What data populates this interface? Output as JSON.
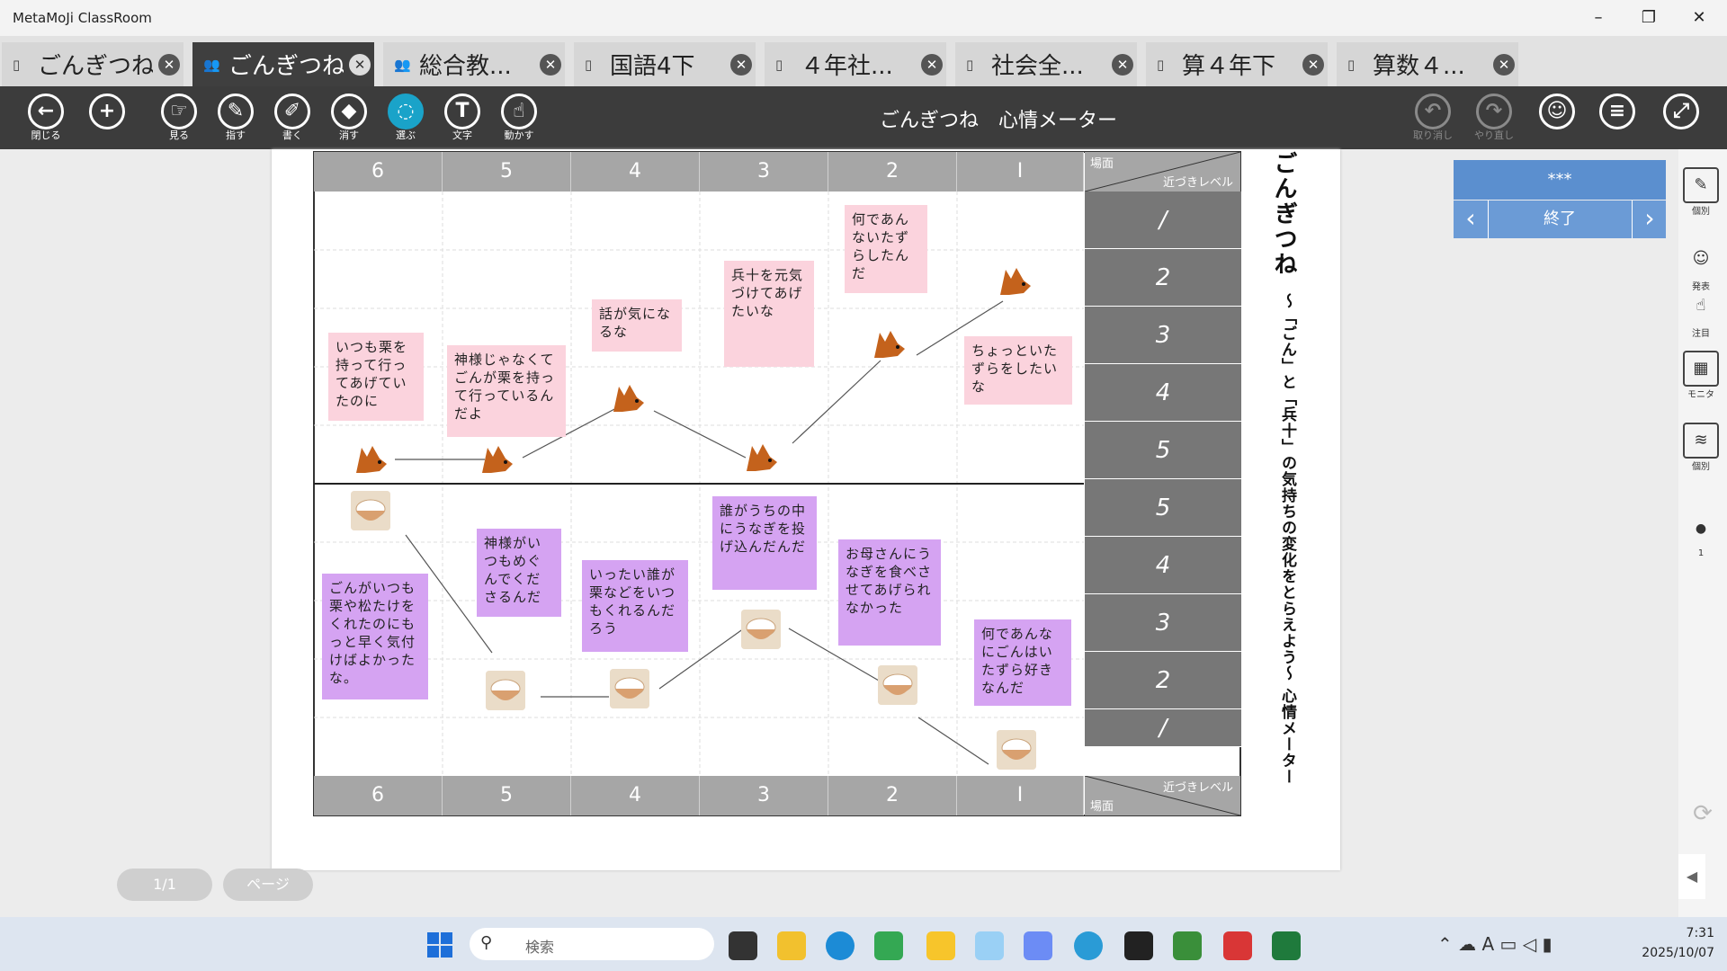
{
  "window": {
    "title": "MetaMoJi ClassRoom",
    "minimize": "–",
    "maximize": "❐",
    "close": "✕"
  },
  "tabs": [
    {
      "label": "ごんぎつね...",
      "icon": "▯",
      "close": "✕"
    },
    {
      "label": "ごんぎつね...",
      "icon": "👥",
      "close": "✕"
    },
    {
      "label": "総合教...",
      "icon": "👥",
      "close": "✕"
    },
    {
      "label": "国語4下",
      "icon": "▯",
      "close": "✕"
    },
    {
      "label": "４年社...",
      "icon": "▯",
      "close": "✕"
    },
    {
      "label": "社会全...",
      "icon": "▯",
      "close": "✕"
    },
    {
      "label": "算４年下",
      "icon": "▯",
      "close": "✕"
    },
    {
      "label": "算数４...",
      "icon": "▯",
      "close": "✕"
    }
  ],
  "toolbar": {
    "close": "閉じる",
    "view": "見る",
    "point": "指す",
    "write": "書く",
    "erase": "消す",
    "select": "選ぶ",
    "text": "文字",
    "move": "動かす",
    "undo": "取り消し",
    "redo": "やり直し",
    "doc_title": "ごんぎつね　心情メーター"
  },
  "sheet": {
    "scenes": [
      "6",
      "5",
      "4",
      "3",
      "2",
      "I"
    ],
    "corner_top": "場面",
    "corner_level": "近づきレベル",
    "levels_top": [
      "/",
      "2",
      "3",
      "4",
      "5"
    ],
    "levels_bottom": [
      "5",
      "4",
      "3",
      "2",
      "/"
    ],
    "title_vertical": "ごんぎつね",
    "subtitle_vertical": "〜「ごん」と「兵十」の気持ちの変化をとらえよう〜 心情メーター 〜",
    "gon_notes": [
      "いつも栗を持って行ってあげていたのに",
      "神様じゃなくてごんが栗を持って行っているんだよ",
      "話が気になるな",
      "兵十を元気づけてあげたいな",
      "何であんないたずらしたんだ",
      "ちょっといたずらをしたいな"
    ],
    "hyoju_notes": [
      "ごんがいつも栗や松たけをくれたのにもっと早く気付けばよかったな。",
      "神様がいつもめぐんでくださるんだ",
      "いったい誰が栗などをいつもくれるんだろう",
      "誰がうちの中にうなぎを投げ込んだんだ",
      "お母さんにうなぎを食べさせてあげられなかった",
      "何であんなにごんはいたずら好きなんだ"
    ]
  },
  "panel": {
    "masked": "***",
    "prev": "‹",
    "end": "終了",
    "next": "›"
  },
  "side_tools": [
    {
      "label": "個別",
      "icon": "✎"
    },
    {
      "label": "発表",
      "icon": "☺"
    },
    {
      "label": "注目",
      "icon": "☝"
    },
    {
      "label": "モニタ",
      "icon": "▦"
    },
    {
      "label": "個別",
      "icon": "≋"
    },
    {
      "label": "1",
      "icon": "●"
    }
  ],
  "page": {
    "indicator": "1/1",
    "page_button": "ページ"
  },
  "taskbar": {
    "search_placeholder": "検索",
    "time": "7:31",
    "date": "2025/10/07"
  },
  "colors": {
    "toolbar": "#3c3c3c",
    "selected_tool": "#1aa3c9",
    "pink_note": "#fbd3dd",
    "purple_note": "#d5a3f2",
    "panel": "#5b8fcf"
  }
}
